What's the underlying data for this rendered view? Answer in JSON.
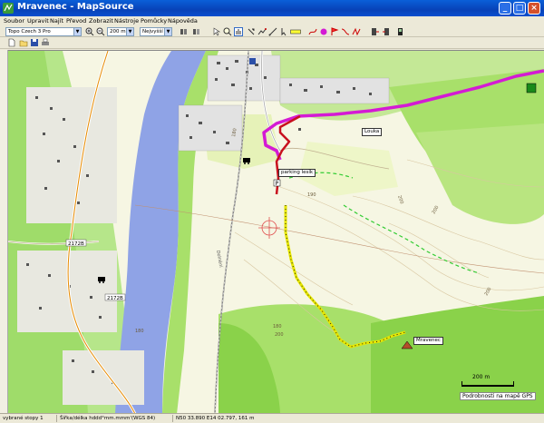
{
  "window": {
    "title": "Mravenec - MapSource"
  },
  "menu": [
    "Soubor",
    "Upravit",
    "Najít",
    "Převod",
    "Zobrazit",
    "Nástroje",
    "Pomůcky",
    "Nápověda"
  ],
  "toolbar": {
    "product": "Topo Czech 3 Pro",
    "zoom_scale": "200 m",
    "detail": "Nejvyšší"
  },
  "map": {
    "waypoint_labels": {
      "louka": "Louka",
      "parking": "parking lesík",
      "mravenec": "Mravenec"
    },
    "road_labels": {
      "r1": "2172B",
      "r2": "2172B",
      "r3": "Dolnění"
    },
    "elevation_labels": [
      "180",
      "200",
      "200",
      "180",
      "200",
      "180",
      "200",
      "190",
      "200"
    ],
    "scale": "200 m",
    "detail_notice": "Podrobnosti na mapě GPS",
    "colors": {
      "water": "#8fa3e6",
      "field": "#f7f7e4",
      "forest": "#a8e06a",
      "forest_dark": "#8ad24a",
      "route": "#d41ad4",
      "track": "#e6e600",
      "trackline": "#c8101e"
    }
  },
  "status": {
    "selection": "vybrané stopy 1",
    "lengths": "Šířka/délka hddd°mm.mmm'(WGS 84)",
    "coords": "N50 33.890 E14 02.797, 161 m"
  }
}
